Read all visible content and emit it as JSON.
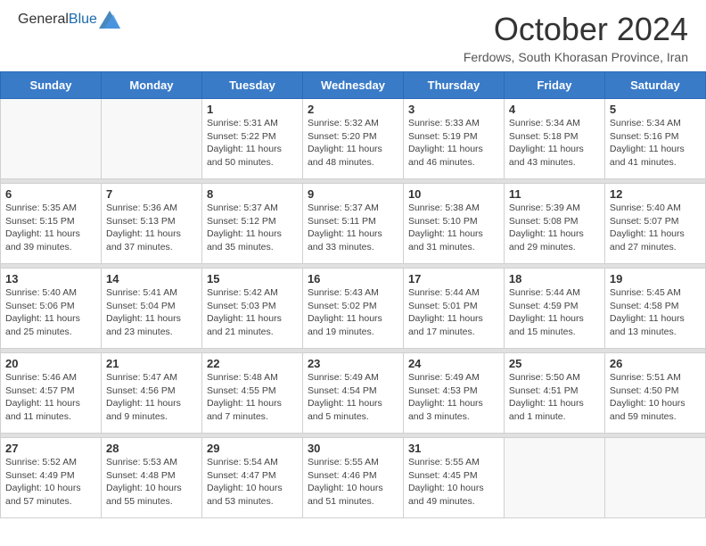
{
  "header": {
    "logo_general": "General",
    "logo_blue": "Blue",
    "month_title": "October 2024",
    "location": "Ferdows, South Khorasan Province, Iran"
  },
  "day_headers": [
    "Sunday",
    "Monday",
    "Tuesday",
    "Wednesday",
    "Thursday",
    "Friday",
    "Saturday"
  ],
  "weeks": [
    [
      {
        "day": "",
        "sunrise": "",
        "sunset": "",
        "daylight": ""
      },
      {
        "day": "",
        "sunrise": "",
        "sunset": "",
        "daylight": ""
      },
      {
        "day": "1",
        "sunrise": "Sunrise: 5:31 AM",
        "sunset": "Sunset: 5:22 PM",
        "daylight": "Daylight: 11 hours and 50 minutes."
      },
      {
        "day": "2",
        "sunrise": "Sunrise: 5:32 AM",
        "sunset": "Sunset: 5:20 PM",
        "daylight": "Daylight: 11 hours and 48 minutes."
      },
      {
        "day": "3",
        "sunrise": "Sunrise: 5:33 AM",
        "sunset": "Sunset: 5:19 PM",
        "daylight": "Daylight: 11 hours and 46 minutes."
      },
      {
        "day": "4",
        "sunrise": "Sunrise: 5:34 AM",
        "sunset": "Sunset: 5:18 PM",
        "daylight": "Daylight: 11 hours and 43 minutes."
      },
      {
        "day": "5",
        "sunrise": "Sunrise: 5:34 AM",
        "sunset": "Sunset: 5:16 PM",
        "daylight": "Daylight: 11 hours and 41 minutes."
      }
    ],
    [
      {
        "day": "6",
        "sunrise": "Sunrise: 5:35 AM",
        "sunset": "Sunset: 5:15 PM",
        "daylight": "Daylight: 11 hours and 39 minutes."
      },
      {
        "day": "7",
        "sunrise": "Sunrise: 5:36 AM",
        "sunset": "Sunset: 5:13 PM",
        "daylight": "Daylight: 11 hours and 37 minutes."
      },
      {
        "day": "8",
        "sunrise": "Sunrise: 5:37 AM",
        "sunset": "Sunset: 5:12 PM",
        "daylight": "Daylight: 11 hours and 35 minutes."
      },
      {
        "day": "9",
        "sunrise": "Sunrise: 5:37 AM",
        "sunset": "Sunset: 5:11 PM",
        "daylight": "Daylight: 11 hours and 33 minutes."
      },
      {
        "day": "10",
        "sunrise": "Sunrise: 5:38 AM",
        "sunset": "Sunset: 5:10 PM",
        "daylight": "Daylight: 11 hours and 31 minutes."
      },
      {
        "day": "11",
        "sunrise": "Sunrise: 5:39 AM",
        "sunset": "Sunset: 5:08 PM",
        "daylight": "Daylight: 11 hours and 29 minutes."
      },
      {
        "day": "12",
        "sunrise": "Sunrise: 5:40 AM",
        "sunset": "Sunset: 5:07 PM",
        "daylight": "Daylight: 11 hours and 27 minutes."
      }
    ],
    [
      {
        "day": "13",
        "sunrise": "Sunrise: 5:40 AM",
        "sunset": "Sunset: 5:06 PM",
        "daylight": "Daylight: 11 hours and 25 minutes."
      },
      {
        "day": "14",
        "sunrise": "Sunrise: 5:41 AM",
        "sunset": "Sunset: 5:04 PM",
        "daylight": "Daylight: 11 hours and 23 minutes."
      },
      {
        "day": "15",
        "sunrise": "Sunrise: 5:42 AM",
        "sunset": "Sunset: 5:03 PM",
        "daylight": "Daylight: 11 hours and 21 minutes."
      },
      {
        "day": "16",
        "sunrise": "Sunrise: 5:43 AM",
        "sunset": "Sunset: 5:02 PM",
        "daylight": "Daylight: 11 hours and 19 minutes."
      },
      {
        "day": "17",
        "sunrise": "Sunrise: 5:44 AM",
        "sunset": "Sunset: 5:01 PM",
        "daylight": "Daylight: 11 hours and 17 minutes."
      },
      {
        "day": "18",
        "sunrise": "Sunrise: 5:44 AM",
        "sunset": "Sunset: 4:59 PM",
        "daylight": "Daylight: 11 hours and 15 minutes."
      },
      {
        "day": "19",
        "sunrise": "Sunrise: 5:45 AM",
        "sunset": "Sunset: 4:58 PM",
        "daylight": "Daylight: 11 hours and 13 minutes."
      }
    ],
    [
      {
        "day": "20",
        "sunrise": "Sunrise: 5:46 AM",
        "sunset": "Sunset: 4:57 PM",
        "daylight": "Daylight: 11 hours and 11 minutes."
      },
      {
        "day": "21",
        "sunrise": "Sunrise: 5:47 AM",
        "sunset": "Sunset: 4:56 PM",
        "daylight": "Daylight: 11 hours and 9 minutes."
      },
      {
        "day": "22",
        "sunrise": "Sunrise: 5:48 AM",
        "sunset": "Sunset: 4:55 PM",
        "daylight": "Daylight: 11 hours and 7 minutes."
      },
      {
        "day": "23",
        "sunrise": "Sunrise: 5:49 AM",
        "sunset": "Sunset: 4:54 PM",
        "daylight": "Daylight: 11 hours and 5 minutes."
      },
      {
        "day": "24",
        "sunrise": "Sunrise: 5:49 AM",
        "sunset": "Sunset: 4:53 PM",
        "daylight": "Daylight: 11 hours and 3 minutes."
      },
      {
        "day": "25",
        "sunrise": "Sunrise: 5:50 AM",
        "sunset": "Sunset: 4:51 PM",
        "daylight": "Daylight: 11 hours and 1 minute."
      },
      {
        "day": "26",
        "sunrise": "Sunrise: 5:51 AM",
        "sunset": "Sunset: 4:50 PM",
        "daylight": "Daylight: 10 hours and 59 minutes."
      }
    ],
    [
      {
        "day": "27",
        "sunrise": "Sunrise: 5:52 AM",
        "sunset": "Sunset: 4:49 PM",
        "daylight": "Daylight: 10 hours and 57 minutes."
      },
      {
        "day": "28",
        "sunrise": "Sunrise: 5:53 AM",
        "sunset": "Sunset: 4:48 PM",
        "daylight": "Daylight: 10 hours and 55 minutes."
      },
      {
        "day": "29",
        "sunrise": "Sunrise: 5:54 AM",
        "sunset": "Sunset: 4:47 PM",
        "daylight": "Daylight: 10 hours and 53 minutes."
      },
      {
        "day": "30",
        "sunrise": "Sunrise: 5:55 AM",
        "sunset": "Sunset: 4:46 PM",
        "daylight": "Daylight: 10 hours and 51 minutes."
      },
      {
        "day": "31",
        "sunrise": "Sunrise: 5:55 AM",
        "sunset": "Sunset: 4:45 PM",
        "daylight": "Daylight: 10 hours and 49 minutes."
      },
      {
        "day": "",
        "sunrise": "",
        "sunset": "",
        "daylight": ""
      },
      {
        "day": "",
        "sunrise": "",
        "sunset": "",
        "daylight": ""
      }
    ]
  ]
}
